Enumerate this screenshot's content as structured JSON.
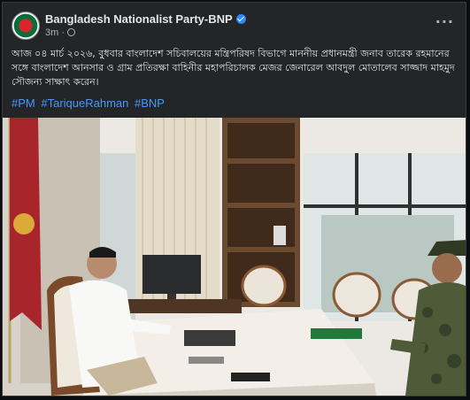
{
  "post": {
    "page_name": "Bangladesh Nationalist Party-BNP",
    "timestamp": "3m",
    "more_label": "···",
    "text": "আজ ০৪ মার্চ ২০২৬, বুধবার বাংলাদেশ সচিবালয়ের মন্ত্রিপরিষদ বিভাগে মাননীয় প্রধানমন্ত্রী জনাব তারেক রহমানের সঙ্গে বাংলাদেশ আনসার ও গ্রাম প্রতিরক্ষা বাহিনীর মহাপরিচালক মেজর জেনারেল আবদুল মোতালেব সাজ্জাদ মাহমুদ সৌজন্য সাক্ষাৎ করেন।",
    "hashtags": [
      "#PM",
      "#TariqueRahman",
      "#BNP"
    ]
  },
  "icons": {
    "avatar": "bnp-logo-avatar",
    "verified": "verified-badge-icon",
    "audience": "globe-icon",
    "more": "more-options-icon"
  },
  "colors": {
    "background": "#242526",
    "text": "#e4e6eb",
    "secondary_text": "#b0b3b8",
    "link": "#4599ff",
    "verified": "#2d88ff"
  }
}
